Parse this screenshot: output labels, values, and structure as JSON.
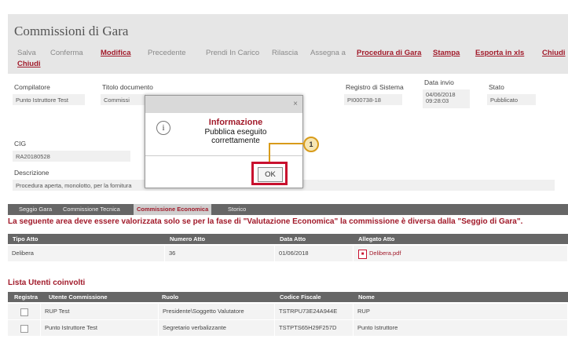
{
  "window": {
    "title": "Commissioni di Gara"
  },
  "toolbar": {
    "salva": "Salva",
    "conferma": "Conferma",
    "modifica": "Modifica",
    "precedente": "Precedente",
    "prendi_in_carico": "Prendi In Carico",
    "rilascia": "Rilascia",
    "assegna_a": "Assegna a",
    "procedura_di_gara": "Procedura di Gara",
    "stampa": "Stampa",
    "esporta_in_xls": "Esporta in xls",
    "chiudi_right": "Chiudi",
    "chiudi": "Chiudi"
  },
  "header_fields": {
    "compilatore_label": "Compilatore",
    "compilatore_value": "Punto Istruttore Test",
    "titolo_label": "Titolo documento",
    "titolo_value": "Commissi",
    "registro_label": "Registro di Sistema",
    "registro_value": "PI000738-18",
    "data_invio_label": "Data invio",
    "data_invio_date": "04/06/2018",
    "data_invio_time": "09:28:03",
    "stato_label": "Stato",
    "stato_value": "Pubblicato"
  },
  "cig": {
    "label": "CIG",
    "value": "RA20180528"
  },
  "descrizione": {
    "label": "Descrizione",
    "value": "Procedura aperta, monolotto, per la fornitura"
  },
  "tabs": [
    {
      "label": "Seggio Gara"
    },
    {
      "label": "Commissione Tecnica"
    },
    {
      "label": "Commissione Economica"
    },
    {
      "label": "Storico"
    }
  ],
  "notice": "La seguente area deve essere valorizzata solo se per la fase di \"Valutazione Economica\" la commissione è diversa dalla \"Seggio di Gara\".",
  "atti_table": {
    "headers": [
      "Tipo Atto",
      "Numero Atto",
      "Data Atto",
      "Allegato Atto"
    ],
    "rows": [
      [
        "Delibera",
        "36",
        "01/06/2018",
        "Delibera.pdf"
      ]
    ]
  },
  "utenti_section": {
    "title": "Lista Utenti coinvolti"
  },
  "utenti_table": {
    "headers": [
      "Registra",
      "Utente Commissione",
      "Ruolo",
      "Codice Fiscale",
      "Nome"
    ],
    "rows": [
      [
        "",
        "RUP Test",
        "Presidente\\Soggetto Valutatore",
        "TSTRPU73E24A944E",
        "RUP"
      ],
      [
        "",
        "Punto Istruttore Test",
        "Segretario verbalizzante",
        "TSTPTS65H29F257D",
        "Punto Istruttore"
      ]
    ]
  },
  "modal": {
    "close_glyph": "×",
    "icon_glyph": "i",
    "title": "Informazione",
    "message_line1": "Pubblica eseguito",
    "message_line2": "correttamente",
    "ok_label": "OK"
  },
  "callout": {
    "number": "1"
  },
  "colors": {
    "accent": "#a11a2a",
    "highlight": "#c8102e",
    "callout": "#d89b1a"
  }
}
